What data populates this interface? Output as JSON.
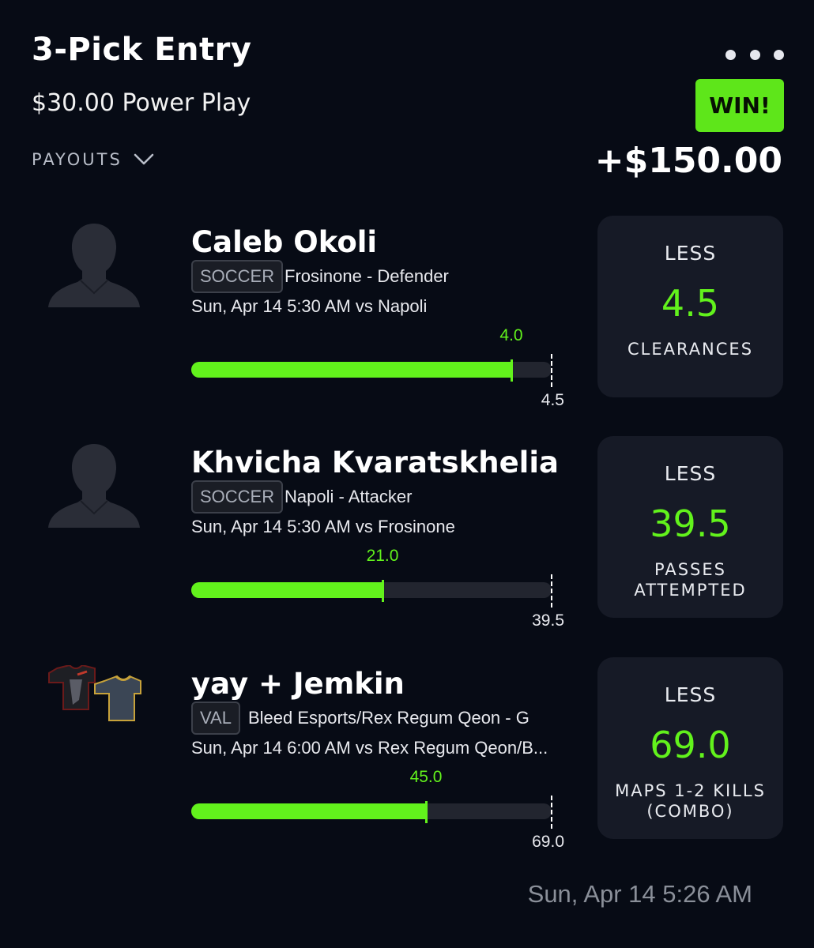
{
  "header": {
    "title": "3-Pick Entry",
    "subtitle": "$30.00 Power Play",
    "payouts_label": "PAYOUTS",
    "status_badge": "WIN!",
    "payout_amount": "+$150.00"
  },
  "colors": {
    "background": "#070b15",
    "accent_green": "#62f21c",
    "card": "#161a26",
    "badge_green": "#5ee61a"
  },
  "picks": [
    {
      "player_name": "Caleb Okoli",
      "sport": "SOCCER",
      "team_position": "Frosinone - Defender",
      "game_time": "Sun, Apr 14 5:30 AM  vs Napoli",
      "actual": "4.0",
      "actual_value": 4.0,
      "line_label": "4.5",
      "line_value": 4.5,
      "direction": "LESS",
      "line": "4.5",
      "stat": "CLEARANCES",
      "avatar_icon": "player-silhouette-icon"
    },
    {
      "player_name": "Khvicha Kvaratskhelia",
      "sport": "SOCCER",
      "team_position": "Napoli - Attacker",
      "game_time": "Sun, Apr 14 5:30 AM  vs Frosinone",
      "actual": "21.0",
      "actual_value": 21.0,
      "line_label": "39.5",
      "line_value": 39.5,
      "direction": "LESS",
      "line": "39.5",
      "stat": "PASSES ATTEMPTED",
      "avatar_icon": "player-silhouette-icon"
    },
    {
      "player_name": "yay + Jemkin",
      "sport": "VAL",
      "team_position": "Bleed Esports/Rex Regum Qeon - G",
      "game_time": "Sun, Apr 14 6:00 AM  vs Rex Regum Qeon/B...",
      "actual": "45.0",
      "actual_value": 45.0,
      "line_label": "69.0",
      "line_value": 69.0,
      "direction": "LESS",
      "line": "69.0",
      "stat": "MAPS 1-2 KILLS (COMBO)",
      "avatar_icon": "team-jerseys-icon"
    }
  ],
  "footer": {
    "timestamp": "Sun, Apr 14 5:26 AM"
  }
}
